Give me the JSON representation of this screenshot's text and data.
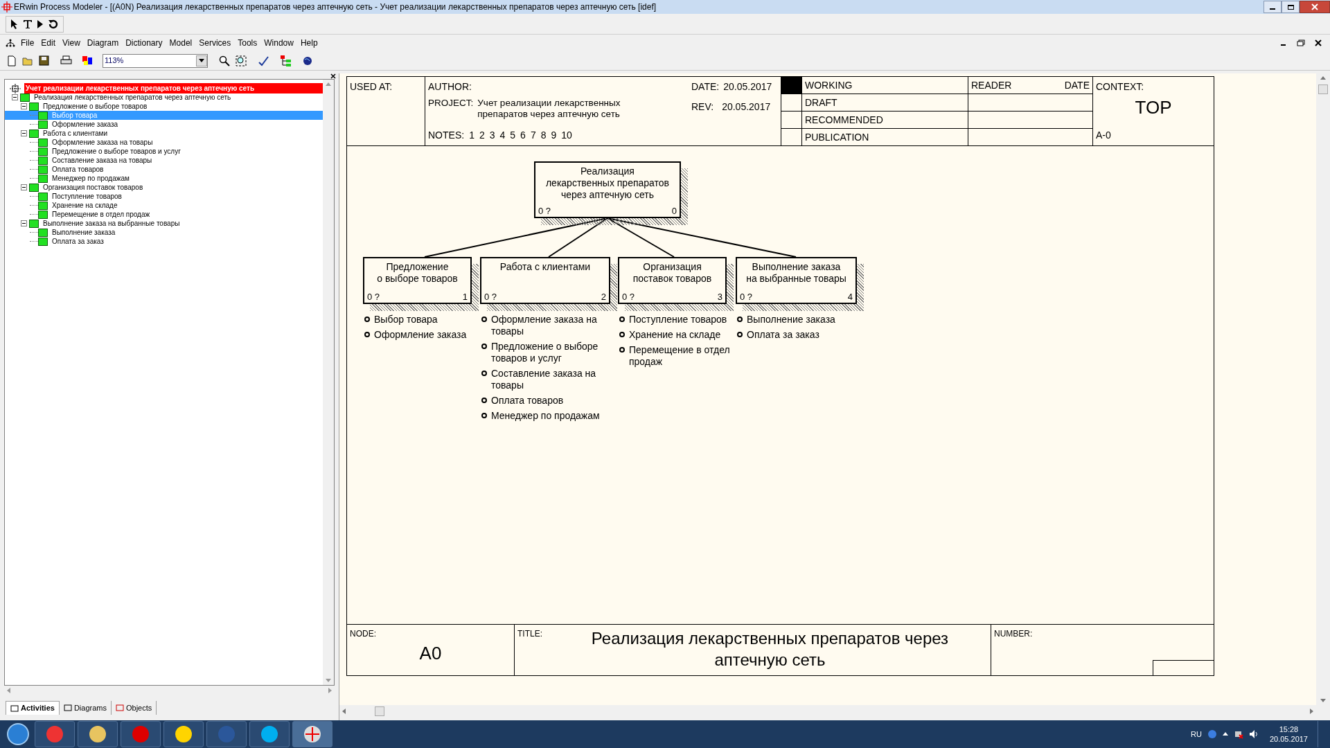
{
  "window": {
    "title": "ERwin Process Modeler - [(A0N) Реализация  лекарственных препаратов  через аптечную сеть - Учет реализации лекарственных препаратов через аптечную сеть  [idef]"
  },
  "menu": [
    "File",
    "Edit",
    "View",
    "Diagram",
    "Dictionary",
    "Model",
    "Services",
    "Tools",
    "Window",
    "Help"
  ],
  "toolbar": {
    "zoom": "113%"
  },
  "tree": {
    "model": "Учет реализации лекарственных препаратов через аптечную сеть",
    "items": [
      {
        "label": "Реализация  лекарственных препаратов  через аптечную сеть",
        "selected": false,
        "expanded": true,
        "children": [
          {
            "label": "Предложение о выборе товаров",
            "selected": false,
            "expanded": true,
            "children": [
              {
                "label": "Выбор товара",
                "selected": true
              },
              {
                "label": "Оформление заказа",
                "selected": false
              }
            ]
          },
          {
            "label": "Работа с клиентами",
            "selected": false,
            "expanded": true,
            "children": [
              {
                "label": "Оформление  заказа на товары",
                "selected": false
              },
              {
                "label": "Предложение о выборе  товаров и услуг",
                "selected": false
              },
              {
                "label": "Составление заказа  на товары",
                "selected": false
              },
              {
                "label": "Оплата товаров",
                "selected": false
              },
              {
                "label": "Менеджер по продажам",
                "selected": false
              }
            ]
          },
          {
            "label": "Организация поставок товаров",
            "selected": false,
            "expanded": true,
            "children": [
              {
                "label": "Поступление товаров",
                "selected": false
              },
              {
                "label": "Хранение на складе",
                "selected": false
              },
              {
                "label": "Перемещение в  отдел продаж",
                "selected": false
              }
            ]
          },
          {
            "label": "Выполнение заказа  на выбранные товары",
            "selected": false,
            "expanded": true,
            "children": [
              {
                "label": "Выполнение заказа",
                "selected": false
              },
              {
                "label": "Оплата за заказ",
                "selected": false
              }
            ]
          }
        ]
      }
    ]
  },
  "explorer_tabs": [
    {
      "label": "Activities",
      "selected": true
    },
    {
      "label": "Diagrams",
      "selected": false
    },
    {
      "label": "Objects",
      "selected": false
    }
  ],
  "diagram": {
    "header": {
      "used_at_label": "USED AT:",
      "author_label": "AUTHOR:",
      "project_label": "PROJECT:",
      "project": "Учет реализации лекарственных препаратов через аптечную сеть",
      "notes_label": "NOTES:",
      "notes": [
        "1",
        "2",
        "3",
        "4",
        "5",
        "6",
        "7",
        "8",
        "9",
        "10"
      ],
      "date_label": "DATE:",
      "date": "20.05.2017",
      "rev_label": "REV:",
      "rev": "20.05.2017",
      "statuses": [
        {
          "label": "WORKING",
          "selected": true
        },
        {
          "label": "DRAFT",
          "selected": false
        },
        {
          "label": "RECOMMENDED",
          "selected": false
        },
        {
          "label": "PUBLICATION",
          "selected": false
        }
      ],
      "reader_label": "READER",
      "reader_date_label": "DATE",
      "context_label": "CONTEXT:",
      "context": "TOP",
      "context_node": "A-0"
    },
    "parent": {
      "name": "Реализация\nлекарственных препаратов\nчерез аптечную сеть",
      "cost": "0 ?",
      "number": "0"
    },
    "children": [
      {
        "name": "Предложение\nо выборе товаров",
        "cost": "0 ?",
        "number": "1",
        "items": [
          "Выбор товара",
          "Оформление заказа"
        ]
      },
      {
        "name": "Работа с клиентами",
        "cost": "0 ?",
        "number": "2",
        "items": [
          "Оформление  заказа на товары",
          "Предложение о выборе товаров и услуг",
          "Составление заказа  на товары",
          "Оплата товаров",
          "Менеджер по продажам"
        ]
      },
      {
        "name": "Организация\nпоставок товаров",
        "cost": "0 ?",
        "number": "3",
        "items": [
          "Поступление товаров",
          "Хранение на складе",
          "Перемещение в отдел продаж"
        ]
      },
      {
        "name": "Выполнение заказа\nна выбранные товары",
        "cost": "0 ?",
        "number": "4",
        "items": [
          "Выполнение заказа",
          "Оплата за заказ"
        ]
      }
    ],
    "footer": {
      "node_label": "NODE:",
      "node": "A0",
      "title_label": "TITLE:",
      "title": "Реализация  лекарственных препаратов  через аптечную сеть",
      "number_label": "NUMBER:"
    }
  },
  "taskbar": {
    "language": "RU",
    "time": "15:28",
    "date": "20.05.2017"
  }
}
